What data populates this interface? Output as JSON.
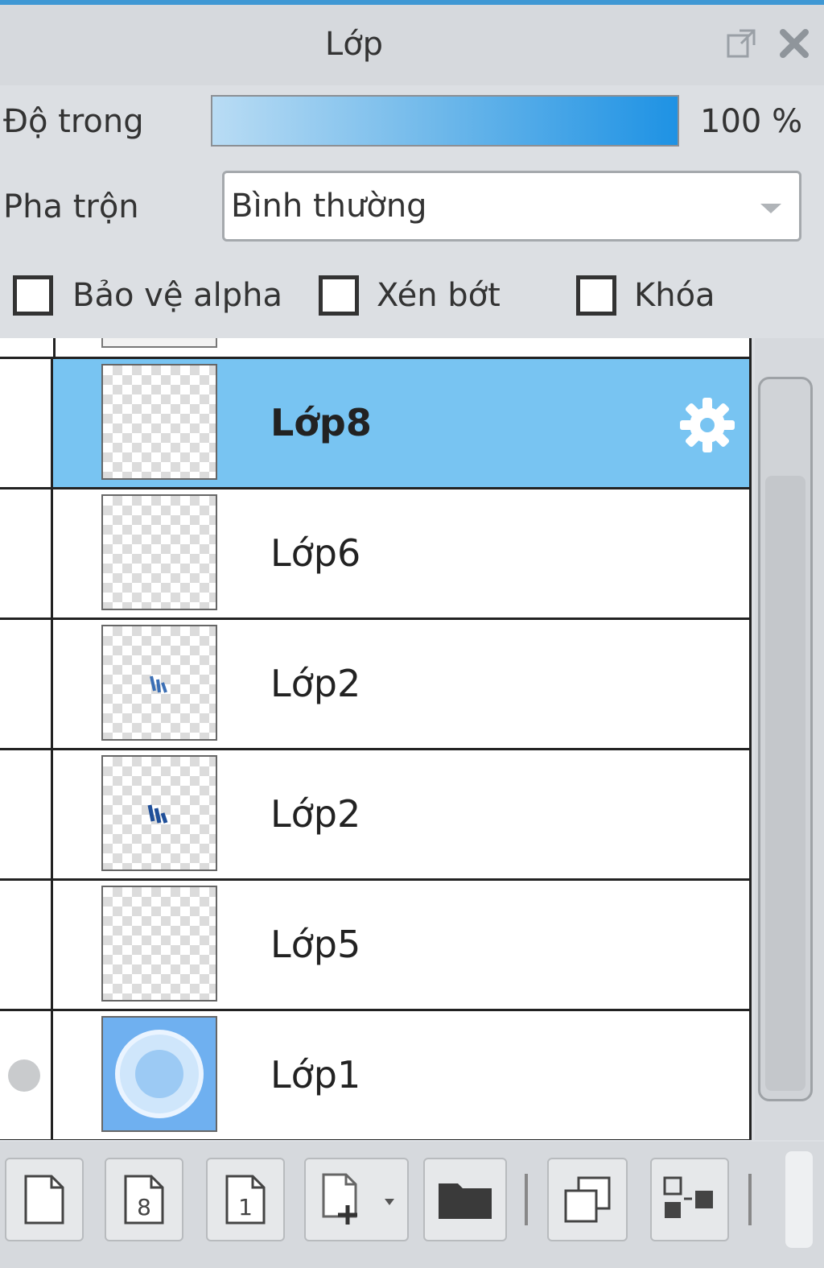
{
  "panel": {
    "title": "Lớp"
  },
  "opacity": {
    "label": "Độ trong",
    "value": 100,
    "value_text": "100 %"
  },
  "blend": {
    "label": "Pha trộn",
    "selected": "Bình thường"
  },
  "options": {
    "protect_alpha": {
      "label": "Bảo vệ alpha",
      "checked": false
    },
    "clipping": {
      "label": "Xén bớt",
      "checked": false
    },
    "lock": {
      "label": "Khóa",
      "checked": false
    }
  },
  "layers": [
    {
      "name": "Lớp8",
      "selected": true,
      "has_settings_icon": true,
      "visible_marker": false
    },
    {
      "name": "Lớp6",
      "selected": false,
      "has_settings_icon": false,
      "visible_marker": false
    },
    {
      "name": "Lớp2",
      "selected": false,
      "has_settings_icon": false,
      "visible_marker": false
    },
    {
      "name": "Lớp2",
      "selected": false,
      "has_settings_icon": false,
      "visible_marker": false
    },
    {
      "name": "Lớp5",
      "selected": false,
      "has_settings_icon": false,
      "visible_marker": false
    },
    {
      "name": "Lớp1",
      "selected": false,
      "has_settings_icon": false,
      "visible_marker": true
    }
  ],
  "toolbar": {
    "buttons": [
      {
        "name": "new-layer",
        "icon": "page-icon"
      },
      {
        "name": "new-8bit-layer",
        "icon": "page-8-icon",
        "text": "8"
      },
      {
        "name": "new-1bit-layer",
        "icon": "page-1-icon",
        "text": "1"
      },
      {
        "name": "add-layer-menu",
        "icon": "page-plus-dropdown-icon"
      },
      {
        "name": "new-folder",
        "icon": "folder-icon"
      },
      {
        "name": "duplicate-layer",
        "icon": "duplicate-icon"
      },
      {
        "name": "transfer-layer",
        "icon": "transfer-icon"
      }
    ]
  }
}
